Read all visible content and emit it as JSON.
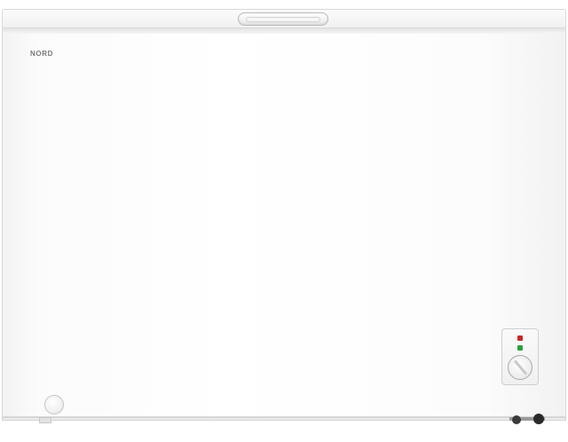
{
  "product": {
    "brand_text": "NORD",
    "body_color": "#ffffff",
    "indicator_red": "#c62828",
    "indicator_green": "#2e9e3e"
  },
  "icons": {
    "lid_handle": "handle-icon",
    "thermostat_dial": "dial-icon",
    "drain_plug": "drain-plug-icon",
    "caster_wheel": "wheel-icon"
  }
}
